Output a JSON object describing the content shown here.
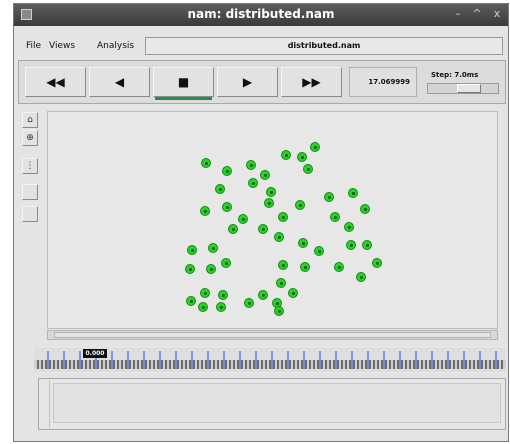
{
  "window": {
    "title": "nam: distributed.nam",
    "minimize_glyph": "–",
    "maximize_glyph": "^",
    "close_glyph": "x"
  },
  "menubar": {
    "items": [
      "File",
      "Views",
      "Analysis"
    ],
    "filename": "distributed.nam"
  },
  "controls": {
    "rewind": "◀◀",
    "back": "◀",
    "stop": "■",
    "play": "▶",
    "fast_forward": "▶▶",
    "time": "17.069999",
    "step_label": "Step: 7.0ms",
    "step_position": 0.62
  },
  "left_toolbar": {
    "buttons": [
      "zoom-in-icon",
      "zoom-out-icon",
      "layout-icon",
      "blank-icon",
      "blank-icon"
    ]
  },
  "timeline": {
    "marker_label": "0.000",
    "marker_position": 0.12
  },
  "colors": {
    "node_fill": "#26d426",
    "node_border": "#138a13",
    "tick_blue": "#2244ee",
    "stop_indicator": "#2a8a4a"
  }
}
